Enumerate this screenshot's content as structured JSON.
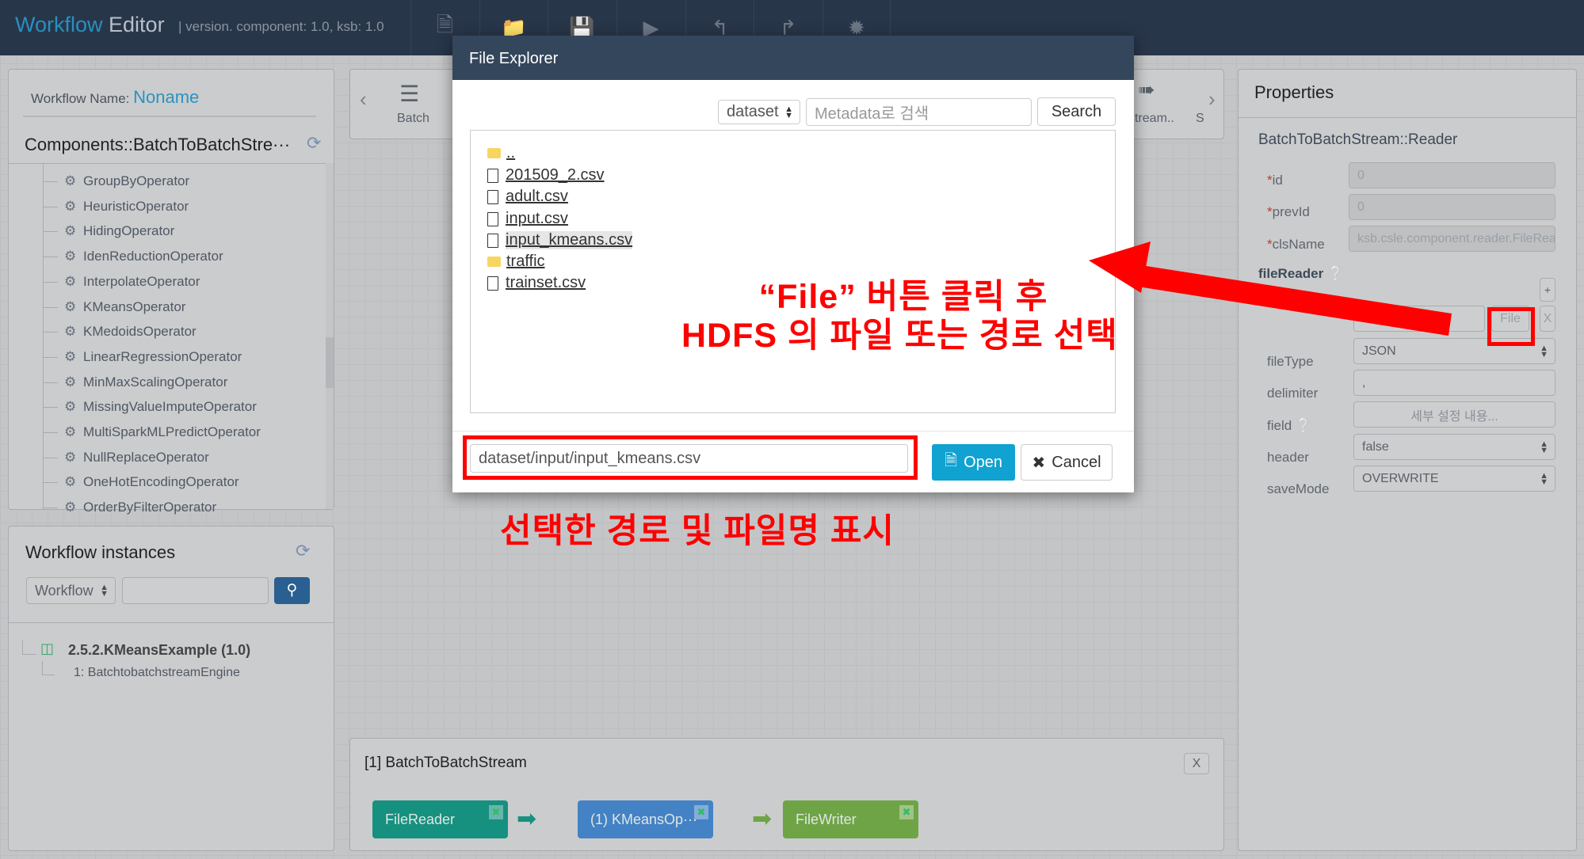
{
  "header": {
    "brand_a": "Workflow",
    "brand_b": " Editor",
    "version": "|  version. component: 1.0, ksb: 1.0",
    "toolbar": [
      "new-file-icon",
      "open-folder-icon",
      "save-icon",
      "run-icon",
      "undo-icon",
      "redo-icon",
      "debug-icon"
    ]
  },
  "left": {
    "workflow_name_label": "Workflow Name:",
    "workflow_name": "Noname",
    "components_title": "Components::BatchToBatchStre···",
    "components": [
      "GroupByOperator",
      "HeuristicOperator",
      "HidingOperator",
      "IdenReductionOperator",
      "InterpolateOperator",
      "KMeansOperator",
      "KMedoidsOperator",
      "LinearRegressionOperator",
      "MinMaxScalingOperator",
      "MissingValueImputeOperator",
      "MultiSparkMLPredictOperator",
      "NullReplaceOperator",
      "OneHotEncodingOperator",
      "OrderByFilterOperator"
    ]
  },
  "instances": {
    "title": "Workflow instances",
    "select": "Workflow",
    "search_value": "",
    "item": "2.5.2.KMeansExample (1.0)",
    "child": "1: BatchtobatchstreamEngine"
  },
  "palette": {
    "batch": "Batch",
    "stream": "tream..",
    "s": "S"
  },
  "properties": {
    "title": "Properties",
    "subtitle": "BatchToBatchStream::Reader",
    "id_label": "id",
    "id": "0",
    "previd_label": "prevId",
    "previd": "0",
    "clsname_label": "clsName",
    "clsname": "ksb.csle.component.reader.FileRea",
    "filereader_label": "fileReader",
    "plus": "+",
    "file_button": "File",
    "remove": "X",
    "filepath": "",
    "filetype_label": "fileType",
    "filetype": "JSON",
    "delimiter_label": "delimiter",
    "delimiter": ",",
    "field_label": "field",
    "field": "세부 설정 내용...",
    "header_label": "header",
    "header": "false",
    "savemode_label": "saveMode",
    "savemode": "OVERWRITE"
  },
  "engine": {
    "title": "[1] BatchToBatchStream",
    "close": "X",
    "nodes": [
      {
        "label": "FileReader",
        "color": "#16907f"
      },
      {
        "label": "(1) KMeansOp···",
        "color": "#4382c5"
      },
      {
        "label": "FileWriter",
        "color": "#6ea445"
      }
    ]
  },
  "dialog": {
    "title": "File Explorer",
    "root_select": "dataset",
    "search_placeholder": "Metadata로 검색",
    "search_button": "Search",
    "files": [
      {
        "name": "..",
        "type": "folder"
      },
      {
        "name": "201509_2.csv",
        "type": "file"
      },
      {
        "name": "adult.csv",
        "type": "file"
      },
      {
        "name": "input.csv",
        "type": "file"
      },
      {
        "name": "input_kmeans.csv",
        "type": "file",
        "selected": true
      },
      {
        "name": "traffic",
        "type": "folder"
      },
      {
        "name": "trainset.csv",
        "type": "file"
      }
    ],
    "path": "dataset/input/input_kmeans.csv",
    "open": "Open",
    "cancel": "Cancel"
  },
  "annotations": {
    "line1": "“File” 버튼 클릭 후",
    "line2": "HDFS 의 파일 또는 경로 선택",
    "line3": "선택한 경로 및 파일명 표시",
    "color": "#ff0000"
  }
}
